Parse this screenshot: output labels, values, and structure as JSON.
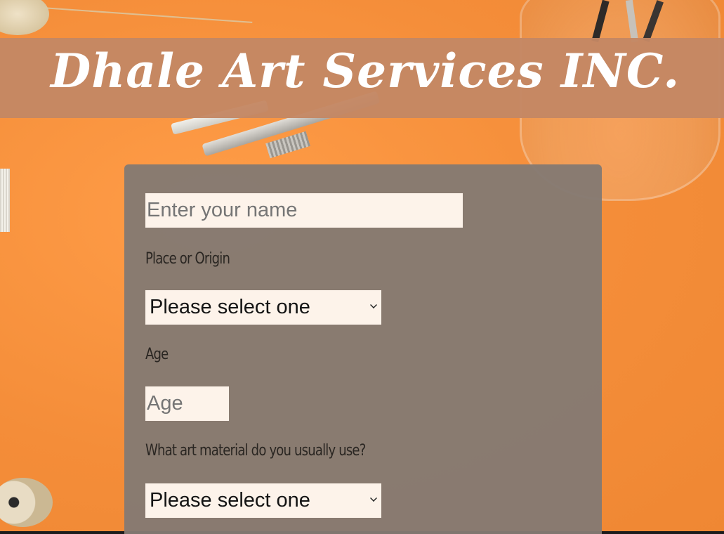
{
  "header": {
    "title": "Dhale Art Services INC."
  },
  "form": {
    "name_field": {
      "placeholder": "Enter your name",
      "value": ""
    },
    "origin": {
      "label": "Place or Origin",
      "selected": "Please select one"
    },
    "age": {
      "label": "Age",
      "placeholder": "Age",
      "value": ""
    },
    "material": {
      "label": "What art material do you usually use?",
      "selected": "Please select one"
    }
  },
  "colors": {
    "background": "#f6923d",
    "banner": "#c48764",
    "card": "#847a72",
    "input_bg": "#fdf3ea",
    "title_text": "#ffffff"
  },
  "icons": {
    "dropdown": "chevron-down-icon"
  }
}
